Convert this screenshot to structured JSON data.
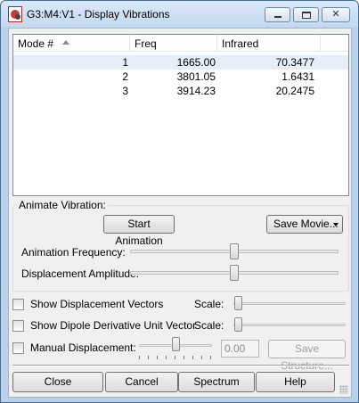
{
  "window": {
    "title": "G3:M4:V1 - Display Vibrations"
  },
  "table": {
    "headers": {
      "mode": "Mode #",
      "freq": "Freq",
      "infrared": "Infrared"
    },
    "rows": [
      {
        "mode": "1",
        "freq": "1665.00",
        "infrared": "70.3477",
        "selected": true
      },
      {
        "mode": "2",
        "freq": "3801.05",
        "infrared": "1.6431",
        "selected": false
      },
      {
        "mode": "3",
        "freq": "3914.23",
        "infrared": "20.2475",
        "selected": false
      }
    ]
  },
  "animate": {
    "group_label": "Animate Vibration:",
    "start_button": "Start Animation",
    "save_movie_button": "Save Movie...",
    "frequency_label": "Animation Frequency:",
    "frequency_level": 0.5,
    "amplitude_label": "Displacement Amplitude:",
    "amplitude_level": 0.5
  },
  "options": {
    "displacement_vectors_label": "Show Displacement Vectors",
    "displacement_vectors_checked": false,
    "dipole_label": "Show Dipole Derivative Unit Vector",
    "dipole_checked": false,
    "scale_label": "Scale:",
    "manual_label": "Manual Displacement:",
    "manual_checked": false,
    "manual_value": "0.00",
    "save_structure_button": "Save Structure..."
  },
  "footer": {
    "close": "Close",
    "cancel": "Cancel",
    "spectrum": "Spectrum",
    "help": "Help"
  }
}
